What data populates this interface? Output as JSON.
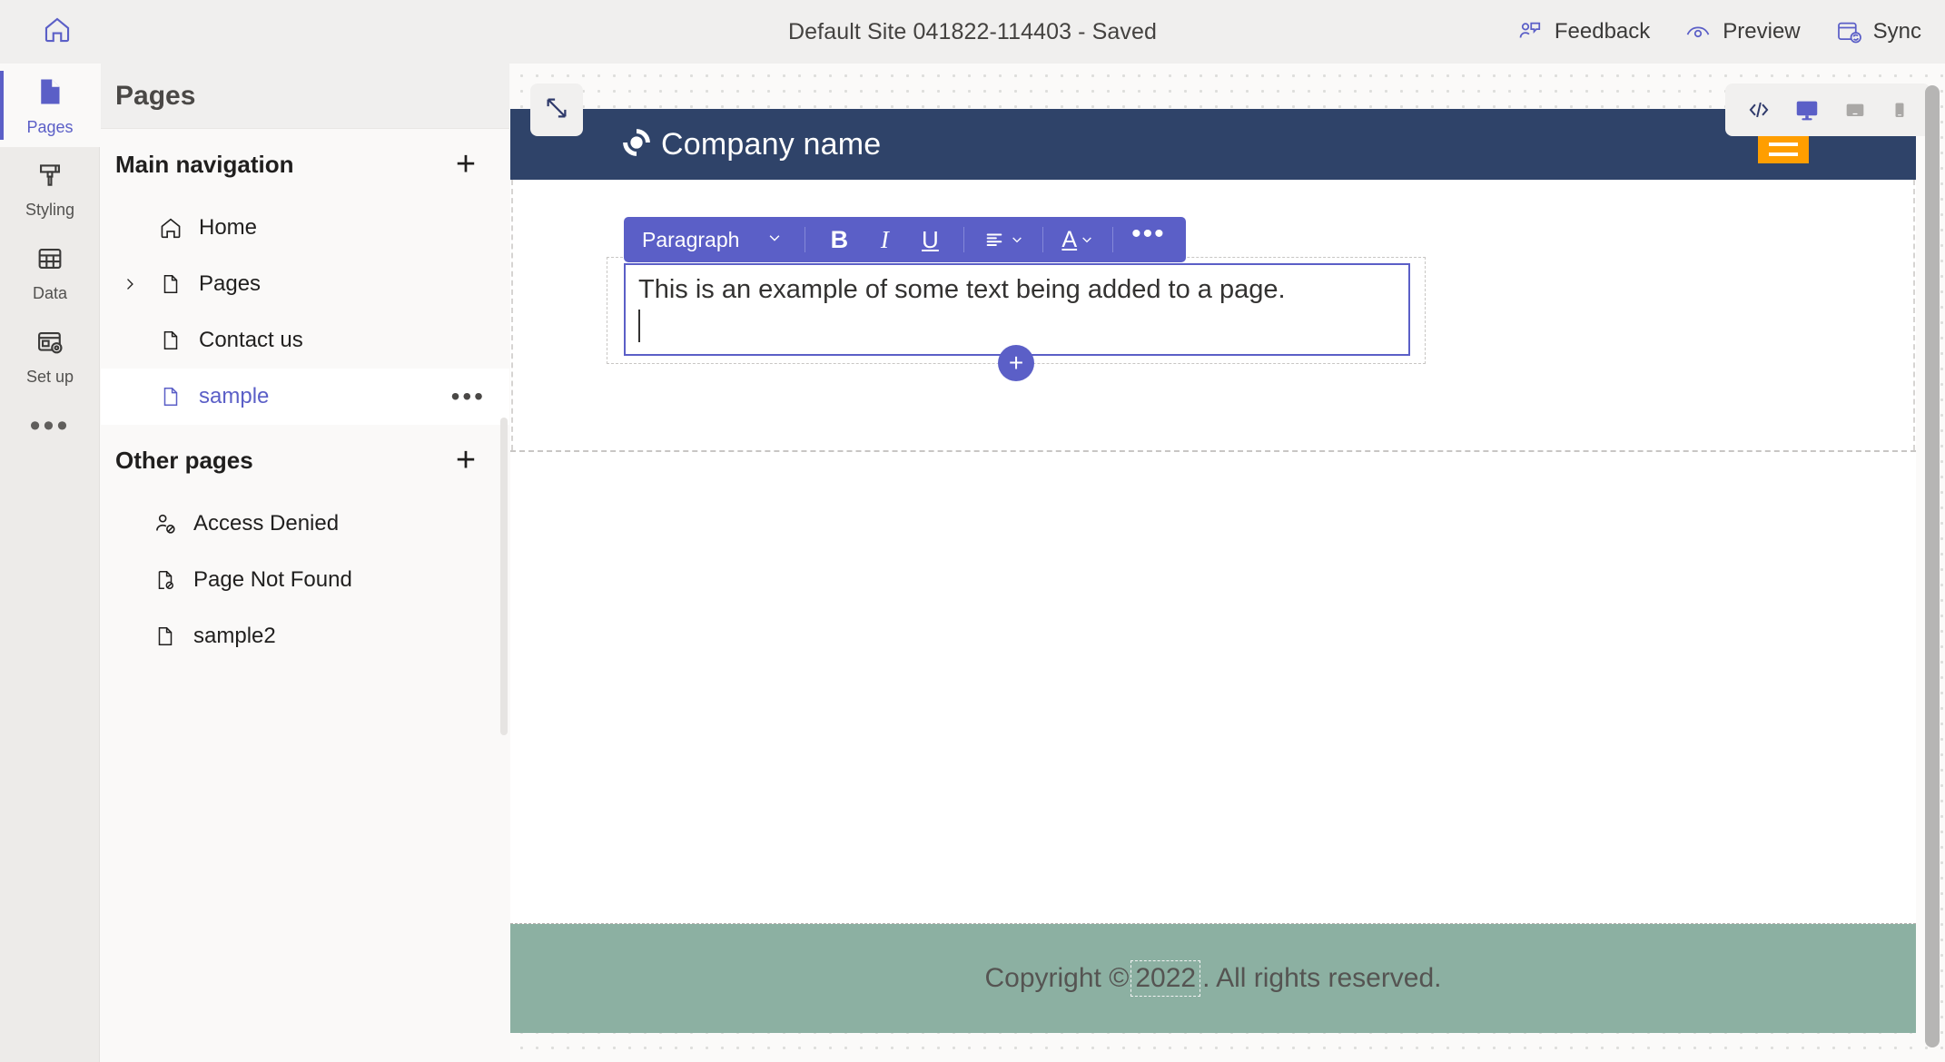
{
  "topbar": {
    "home_icon": "home-icon",
    "title": "Default Site 041822-114403 - Saved",
    "actions": [
      {
        "label": "Feedback",
        "icon": "feedback-icon"
      },
      {
        "label": "Preview",
        "icon": "eye-icon"
      },
      {
        "label": "Sync",
        "icon": "sync-icon"
      }
    ]
  },
  "rail": {
    "items": [
      {
        "label": "Pages",
        "icon": "page-icon",
        "active": true
      },
      {
        "label": "Styling",
        "icon": "paintbrush-icon",
        "active": false
      },
      {
        "label": "Data",
        "icon": "table-icon",
        "active": false
      },
      {
        "label": "Set up",
        "icon": "setup-gear-icon",
        "active": false
      }
    ],
    "more_label": "•••"
  },
  "panel": {
    "title": "Pages",
    "sections": [
      {
        "title": "Main navigation",
        "add_label": "+",
        "items": [
          {
            "label": "Home",
            "icon": "home-outline-icon",
            "expandable": false,
            "selected": false
          },
          {
            "label": "Pages",
            "icon": "page-outline-icon",
            "expandable": true,
            "selected": false
          },
          {
            "label": "Contact us",
            "icon": "page-outline-icon",
            "expandable": false,
            "selected": false
          },
          {
            "label": "sample",
            "icon": "page-outline-icon",
            "expandable": false,
            "selected": true,
            "more_label": "•••"
          }
        ]
      },
      {
        "title": "Other pages",
        "add_label": "+",
        "items": [
          {
            "label": "Access Denied",
            "icon": "person-blocked-icon",
            "expandable": false,
            "selected": false
          },
          {
            "label": "Page Not Found",
            "icon": "page-blocked-icon",
            "expandable": false,
            "selected": false
          },
          {
            "label": "sample2",
            "icon": "page-outline-icon",
            "expandable": false,
            "selected": false
          }
        ]
      }
    ]
  },
  "canvas": {
    "expand_icon": "resize-diagonal-icon",
    "viewport_buttons": [
      {
        "name": "code-icon",
        "label": "</>",
        "active": false
      },
      {
        "name": "desktop-icon",
        "label": "Desktop",
        "active": true
      },
      {
        "name": "tablet-icon",
        "label": "Tablet",
        "active": false
      },
      {
        "name": "mobile-icon",
        "label": "Mobile",
        "active": false
      }
    ]
  },
  "site": {
    "header": {
      "logo_icon": "company-swirl-logo",
      "company_name": "Company name",
      "menu_icon": "hamburger-menu-icon",
      "background": "#2f4369",
      "menu_background": "#ff9e00"
    },
    "editor": {
      "toolbar": {
        "style_label": "Paragraph",
        "style_chevron": "chevron-down-icon",
        "bold_label": "B",
        "italic_label": "I",
        "underline_label": "U",
        "align_icon": "align-left-icon",
        "font_color_label": "A",
        "more_label": "•••",
        "background": "#5b5fc7"
      },
      "text": "This is an example of some text being added to a page.",
      "add_block_label": "+"
    },
    "footer": {
      "text_before": "Copyright © ",
      "year": "2022",
      "text_after": ". All rights reserved.",
      "background": "#8cb0a2"
    }
  }
}
